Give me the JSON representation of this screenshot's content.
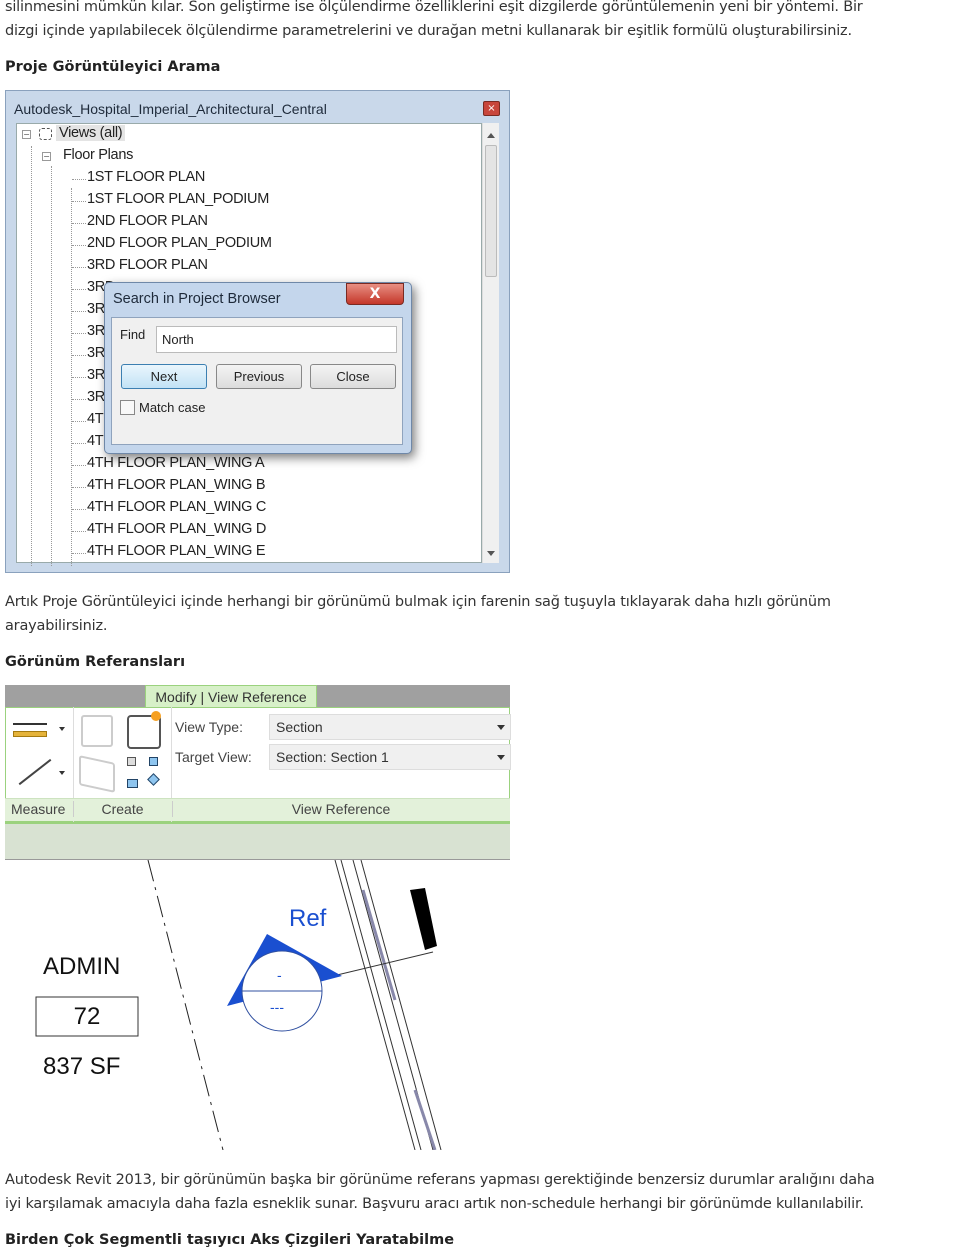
{
  "intro": {
    "line1": "silinmesini mümkün kılar.  Son geliştirme ise ölçülendirme özelliklerini eşit dizgilerde görüntülemenin yeni bir yöntemi. Bir",
    "line2": "dizgi içinde yapılabilecek ölçülendirme parametrelerini ve durağan metni kullanarak bir eşitlik formülü oluşturabilirsiniz."
  },
  "section1": {
    "heading": "Proje Görüntüleyici Arama",
    "browser": {
      "title": "Autodesk_Hospital_Imperial_Architectural_Central",
      "close_glyph": "×",
      "root": "Views (all)",
      "group": "Floor Plans",
      "items": [
        "1ST FLOOR PLAN",
        "1ST FLOOR PLAN_PODIUM",
        "2ND FLOOR PLAN",
        "2ND FLOOR PLAN_PODIUM",
        "3RD FLOOR PLAN",
        "3RD",
        "3RD",
        "3RD",
        "3RD",
        "3RD",
        "3RD",
        "4TH",
        "4TH",
        "4TH FLOOR PLAN_WING A",
        "4TH FLOOR PLAN_WING B",
        "4TH FLOOR PLAN_WING C",
        "4TH FLOOR PLAN_WING D",
        "4TH FLOOR PLAN_WING E"
      ]
    },
    "dialog": {
      "title": "Search in Project Browser",
      "close_glyph": "X",
      "find_label": "Find",
      "find_value": "North",
      "next": "Next",
      "previous": "Previous",
      "close": "Close",
      "match_case": "Match case",
      "match_case_checked": false
    },
    "caption1": "Artık Proje Görüntüleyici içinde herhangi bir görünümü bulmak için farenin sağ tuşuyla tıklayarak daha hızlı görünüm",
    "caption2": "arayabilirsiniz."
  },
  "section2": {
    "heading": "Görünüm Referansları",
    "ribbon": {
      "tab": "Modify | View Reference",
      "view_type_label": "View Type:",
      "view_type_value": "Section",
      "target_view_label": "Target View:",
      "target_view_value": "Section: Section 1",
      "panels": [
        "Measure",
        "Create",
        "View Reference"
      ]
    },
    "drawing": {
      "room_name": "ADMIN",
      "room_number": "72",
      "room_area": "837 SF",
      "ref_label": "Ref",
      "tag_top": "-",
      "tag_bottom": "---",
      "accent": "#1a4fd0"
    },
    "caption1": "Autodesk Revit 2013, bir görünümün başka bir görünüme referans yapması gerektiğinde benzersiz durumlar aralığını daha",
    "caption2": "iyi karşılamak amacıyla daha fazla esneklik sunar.  Başvuru aracı artık non-schedule herhangi bir görünümde kullanılabilir."
  },
  "section3": {
    "heading": "Birden Çok Segmentli taşıyıcı Aks Çizgileri Yaratabilme"
  }
}
